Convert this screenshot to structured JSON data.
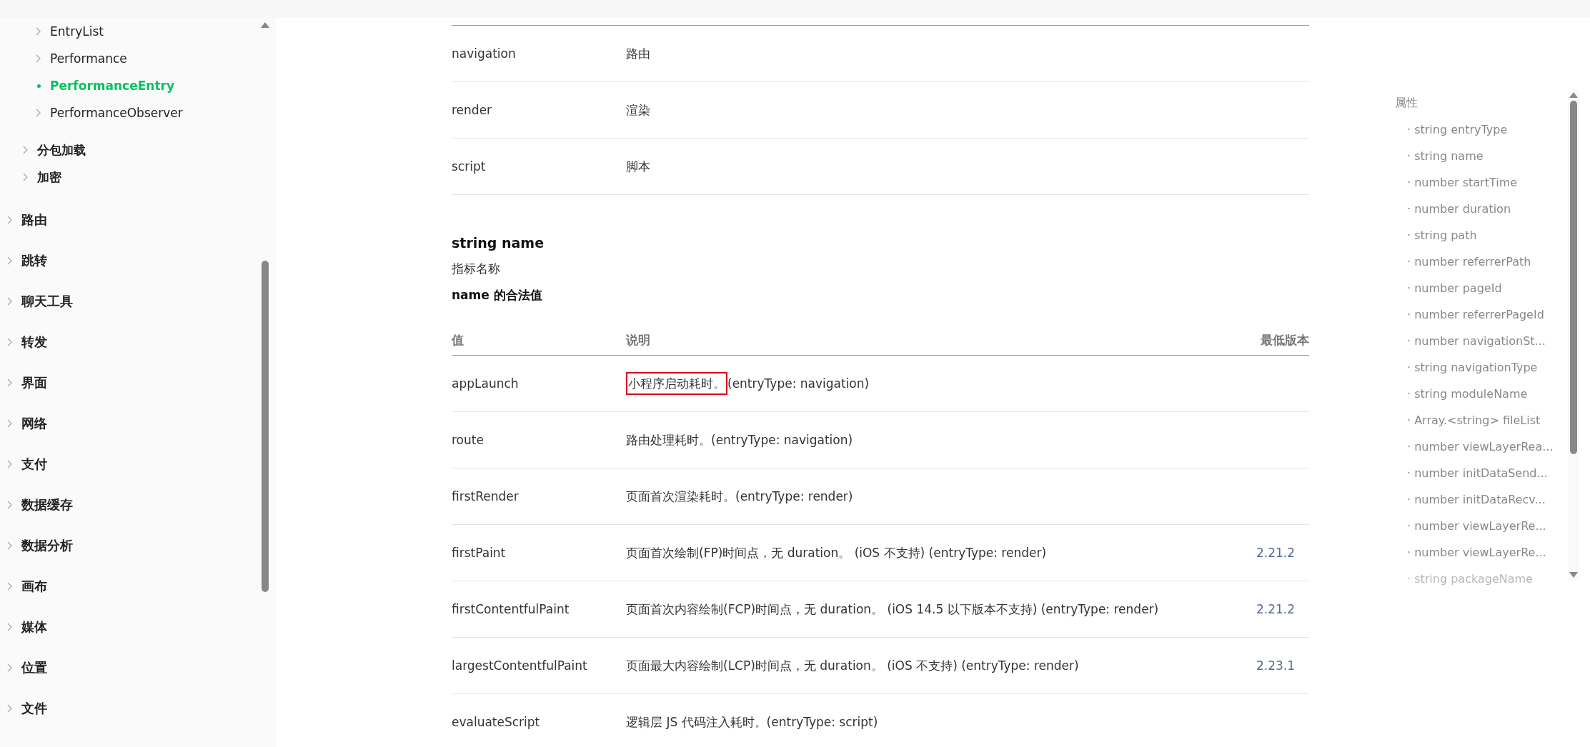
{
  "sidebar": {
    "items": [
      {
        "children": [
          {
            "children": [
              {
                "label": "EntryList",
                "selected": false
              },
              {
                "label": "Performance",
                "selected": false
              },
              {
                "label": "PerformanceEntry",
                "selected": true
              },
              {
                "label": "PerformanceObserver",
                "selected": false
              }
            ]
          },
          {
            "label": "分包加载",
            "selected": false
          },
          {
            "label": "加密",
            "selected": false
          }
        ]
      },
      {
        "label": "路由",
        "selected": false
      },
      {
        "label": "跳转",
        "selected": false
      },
      {
        "label": "聊天工具",
        "selected": false
      },
      {
        "label": "转发",
        "selected": false
      },
      {
        "label": "界面",
        "selected": false
      },
      {
        "label": "网络",
        "selected": false
      },
      {
        "label": "支付",
        "selected": false
      },
      {
        "label": "数据缓存",
        "selected": false
      },
      {
        "label": "数据分析",
        "selected": false
      },
      {
        "label": "画布",
        "selected": false
      },
      {
        "label": "媒体",
        "selected": false
      },
      {
        "label": "位置",
        "selected": false
      },
      {
        "label": "文件",
        "selected": false
      }
    ]
  },
  "entry_type_table": {
    "rows": [
      {
        "value": "navigation",
        "description": "路由"
      },
      {
        "value": "render",
        "description": "渲染"
      },
      {
        "value": "script",
        "description": "脚本"
      }
    ]
  },
  "section": {
    "title": "string name",
    "description": "指标名称",
    "subtitle": "name 的合法值"
  },
  "name_table": {
    "columns": [
      "值",
      "说明",
      "最低版本"
    ],
    "rows": [
      {
        "value": "appLaunch",
        "marked": "小程序启动耗时。",
        "description": "(entryType: navigation)"
      },
      {
        "value": "route",
        "description": "路由处理耗时。(entryType: navigation)"
      },
      {
        "value": "firstRender",
        "description": "页面首次渲染耗时。(entryType: render)"
      },
      {
        "value": "firstPaint",
        "description": "页面首次绘制(FP)时间点，无 duration。 (iOS 不支持) (entryType: render)",
        "version": "2.21.2"
      },
      {
        "value": "firstContentfulPaint",
        "description": "页面首次内容绘制(FCP)时间点，无 duration。 (iOS 14.5 以下版本不支持) (entryType: render)",
        "version": "2.21.2"
      },
      {
        "value": "largestContentfulPaint",
        "description": "页面最大内容绘制(LCP)时间点，无 duration。 (iOS 不支持) (entryType: render)",
        "version": "2.23.1"
      },
      {
        "value": "evaluateScript",
        "description": "逻辑层 JS 代码注入耗时。(entryType: script)"
      }
    ]
  },
  "toc": {
    "title": "属性",
    "items": [
      {
        "label": "· string entryType",
        "faded": false
      },
      {
        "label": "· string name",
        "faded": false
      },
      {
        "label": "· number startTime",
        "faded": false
      },
      {
        "label": "· number duration",
        "faded": false
      },
      {
        "label": "· string path",
        "faded": false
      },
      {
        "label": "· number referrerPath",
        "faded": false
      },
      {
        "label": "· number pageId",
        "faded": false
      },
      {
        "label": "· number referrerPageId",
        "faded": false
      },
      {
        "label": "· number navigationSt...",
        "faded": false
      },
      {
        "label": "· string navigationType",
        "faded": false
      },
      {
        "label": "· string moduleName",
        "faded": false
      },
      {
        "label": "· Array.<string> fileList",
        "faded": false
      },
      {
        "label": "· number viewLayerRea...",
        "faded": false
      },
      {
        "label": "· number initDataSend...",
        "faded": false
      },
      {
        "label": "· number initDataRecv...",
        "faded": false
      },
      {
        "label": "· number viewLayerRe...",
        "faded": false
      },
      {
        "label": "· number viewLayerRe...",
        "faded": false
      },
      {
        "label": "· string packageName",
        "faded": true
      }
    ]
  }
}
